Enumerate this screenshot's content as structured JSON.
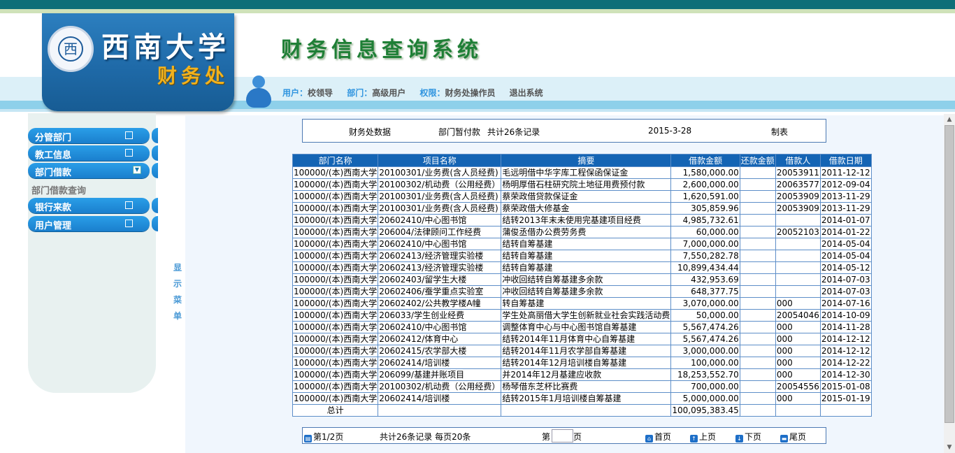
{
  "logo": {
    "emblem_char": "西",
    "name": "西南大学",
    "dept": "财务处"
  },
  "system_title": "财务信息查询系统",
  "user_bar": {
    "user_label": "用户：",
    "user_value": "校领导",
    "dept_label": "部门：",
    "dept_value": "高级用户",
    "role_label": "权限：",
    "role_value": "财务处操作员",
    "logout": "退出系统"
  },
  "menu": [
    {
      "label": "分管部门"
    },
    {
      "label": "教工信息"
    },
    {
      "label": "部门借款"
    },
    {
      "label": "银行来款"
    },
    {
      "label": "用户管理"
    }
  ],
  "submenu": {
    "label": "部门借款查询"
  },
  "vtoggle": "显示菜单",
  "info": {
    "source": "财务处数据",
    "title": "部门暂付款",
    "count": "共计26条记录",
    "date": "2015-3-28",
    "maker": "制表"
  },
  "table": {
    "headers": [
      "部门名称",
      "项目名称",
      "摘要",
      "借款金额",
      "还款金额",
      "借款人",
      "借款日期"
    ],
    "rows": [
      [
        "100000/(本)西南大学",
        "20100301/业务费(含人员经费)",
        "毛远明借中华字库工程保函保证金",
        "1,580,000.00",
        "",
        "20053911",
        "2011-12-12"
      ],
      [
        "100000/(本)西南大学",
        "20100302/机动费（公用经费）",
        "杨明厚借石柱研究院土地征用费预付款",
        "2,600,000.00",
        "",
        "20063577",
        "2012-09-04"
      ],
      [
        "100000/(本)西南大学",
        "20100301/业务费(含人员经费)",
        "蔡荣政借贷款保证金",
        "1,620,591.00",
        "",
        "20053909",
        "2013-11-29"
      ],
      [
        "100000/(本)西南大学",
        "20100301/业务费(含人员经费)",
        "蔡荣政借大修基金",
        "305,859.96",
        "",
        "20053909",
        "2013-11-29"
      ],
      [
        "100000/(本)西南大学",
        "20602410/中心图书馆",
        "结转2013年末未使用完基建项目经费",
        "4,985,732.61",
        "",
        "",
        "2014-01-07"
      ],
      [
        "100000/(本)西南大学",
        "206004/法律顾问工作经费",
        "蒲俊丞借办公费劳务费",
        "60,000.00",
        "",
        "20052103",
        "2014-01-22"
      ],
      [
        "100000/(本)西南大学",
        "20602410/中心图书馆",
        "结转自筹基建",
        "7,000,000.00",
        "",
        "",
        "2014-05-04"
      ],
      [
        "100000/(本)西南大学",
        "20602413/经济管理实验楼",
        "结转自筹基建",
        "7,550,282.78",
        "",
        "",
        "2014-05-04"
      ],
      [
        "100000/(本)西南大学",
        "20602413/经济管理实验楼",
        "结转自筹基建",
        "10,899,434.44",
        "",
        "",
        "2014-05-12"
      ],
      [
        "100000/(本)西南大学",
        "20602403/留学生大楼",
        "冲收回结转自筹基建多余款",
        "432,953.69",
        "",
        "",
        "2014-07-03"
      ],
      [
        "100000/(本)西南大学",
        "20602406/蚕学重点实验室",
        "冲收回结转自筹基建多余款",
        "648,377.75",
        "",
        "",
        "2014-07-03"
      ],
      [
        "100000/(本)西南大学",
        "20602402/公共教学楼A幢",
        "转自筹基建",
        "3,070,000.00",
        "",
        "000",
        "2014-07-16"
      ],
      [
        "100000/(本)西南大学",
        "206033/学生创业经费",
        "学生处高丽借大学生创新就业社会实践活动费",
        "50,000.00",
        "",
        "20054046",
        "2014-10-09"
      ],
      [
        "100000/(本)西南大学",
        "20602410/中心图书馆",
        "调整体育中心与中心图书馆自筹基建",
        "5,567,474.26",
        "",
        "000",
        "2014-11-28"
      ],
      [
        "100000/(本)西南大学",
        "20602412/体育中心",
        "结转2014年11月体育中心自筹基建",
        "5,567,474.26",
        "",
        "000",
        "2014-12-12"
      ],
      [
        "100000/(本)西南大学",
        "20602415/农学部大楼",
        "结转2014年11月农学部自筹基建",
        "3,000,000.00",
        "",
        "000",
        "2014-12-12"
      ],
      [
        "100000/(本)西南大学",
        "20602414/培训楼",
        "结转2014年12月培训楼自筹基建",
        "100,000.00",
        "",
        "000",
        "2014-12-22"
      ],
      [
        "100000/(本)西南大学",
        "206099/基建并账项目",
        "并2014年12月基建应收款",
        "18,253,552.70",
        "",
        "000",
        "2014-12-30"
      ],
      [
        "100000/(本)西南大学",
        "20100302/机动费（公用经费）",
        "杨琴借东芝杯比赛费",
        "700,000.00",
        "",
        "20054556",
        "2015-01-08"
      ],
      [
        "100000/(本)西南大学",
        "20602414/培训楼",
        "结转2015年1月培训楼自筹基建",
        "5,000,000.00",
        "",
        "000",
        "2015-01-19"
      ]
    ],
    "total_label": "总计",
    "total_value": "100,095,383.45"
  },
  "pager": {
    "page_info": "第1/2页",
    "summary": "共计26条记录  每页20条",
    "goto_prefix": "第",
    "goto_value": "",
    "goto_suffix": "页",
    "first": "首页",
    "prev": "上页",
    "next": "下页",
    "last": "尾页"
  }
}
